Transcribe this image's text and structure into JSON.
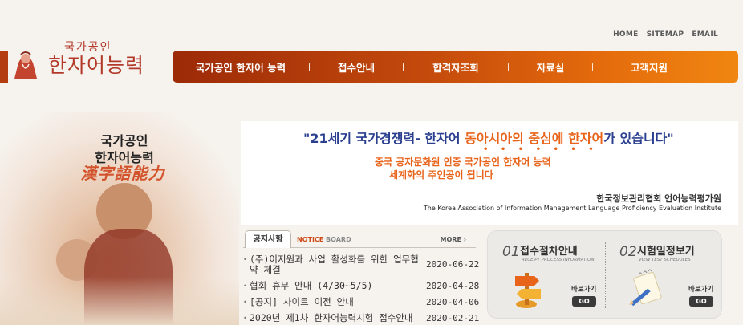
{
  "utility_links": [
    "HOME",
    "SITEMAP",
    "EMAIL"
  ],
  "logo": {
    "small_text": "국가공인",
    "big_text": "한자어능력"
  },
  "nav": [
    {
      "label": "국가공인 한자어 능력"
    },
    {
      "label": "접수안내"
    },
    {
      "label": "합격자조회"
    },
    {
      "label": "자료실"
    },
    {
      "label": "고객지원"
    }
  ],
  "side_panel": {
    "line1": "국가공인",
    "line2": "한자어능력",
    "hanja": "漢字語能力"
  },
  "banner": {
    "headline_part1": "\"21세기 국가경쟁력- 한자어",
    "headline_part2": "동아시아의 중심에 한자어",
    "headline_part3": "가 있습니다\"",
    "dots": "• • • •  • • •",
    "line2": "중국 공자문화원 인증 국가공인 한자어 능력",
    "line3": "세계화의 주인공이 됩니다",
    "org_kr": "한국정보관리협회 언어능력평가원",
    "org_en": "The Korea Association of Information Management Language Proficiency Evaluation Institute"
  },
  "notice": {
    "tab": "공지사항",
    "sub_notice": "NOTICE",
    "sub_board": " BOARD",
    "more": "MORE ›",
    "items": [
      {
        "title": "(주)이지원과 사업 활성화를 위한 업무협약 체결",
        "date": "2020-06-22"
      },
      {
        "title": "협회 휴무 안내 (4/30~5/5)",
        "date": "2020-04-28"
      },
      {
        "title": "[공지] 사이트 이전 안내",
        "date": "2020-04-06"
      },
      {
        "title": "2020년 제1차 한자어능력시험 접수안내",
        "date": "2020-02-21"
      }
    ]
  },
  "quick": [
    {
      "num": "01",
      "title": "접수절차안내",
      "sub": "RECEIPT PROCESS INFORMATION",
      "go_label": "바로가기",
      "go": "GO"
    },
    {
      "num": "02",
      "title": "시험일정보기",
      "sub": "VIEW TEST SCHEDULES",
      "go_label": "바로가기",
      "go": "GO"
    }
  ]
}
